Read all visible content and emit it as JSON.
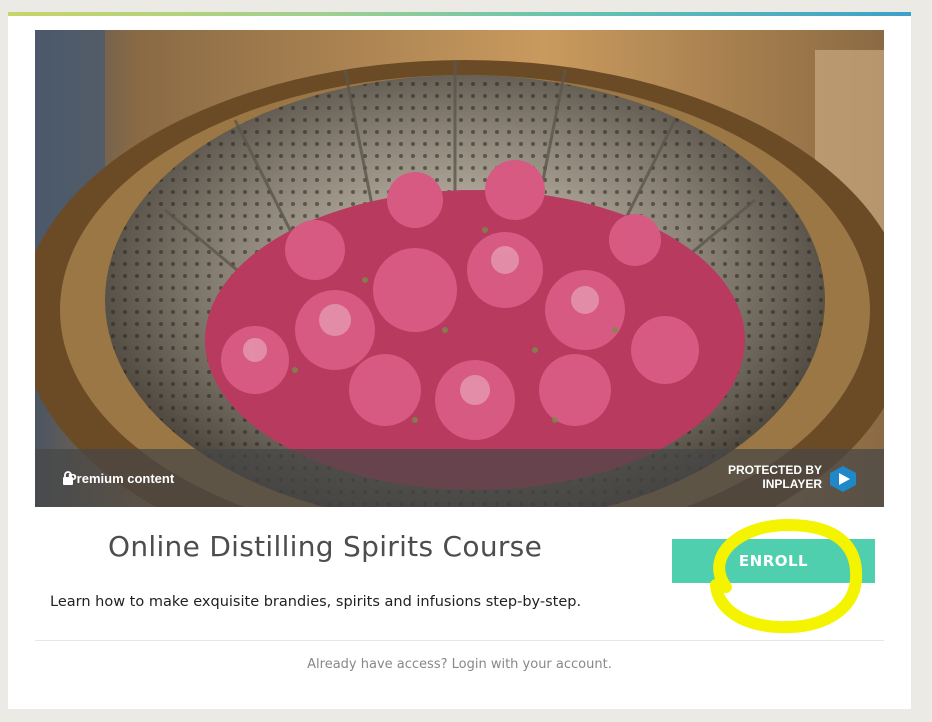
{
  "hero": {
    "premium_label": "Premium content",
    "protected_line1": "PROTECTED BY",
    "protected_line2": "INPLAYER"
  },
  "course": {
    "title": "Online Distilling Spirits Course",
    "description": "Learn how to make exquisite brandies, spirits and infusions step-by-step.",
    "enroll_label": "ENROLL"
  },
  "footer": {
    "login_text": "Already have access? Login with your account."
  },
  "colors": {
    "accent": "#4fcfae",
    "highlight": "#f4f400",
    "inplayer_blue": "#1e88c8"
  },
  "icons": {
    "premium": "lock-icon",
    "brand": "inplayer-logo-icon"
  }
}
